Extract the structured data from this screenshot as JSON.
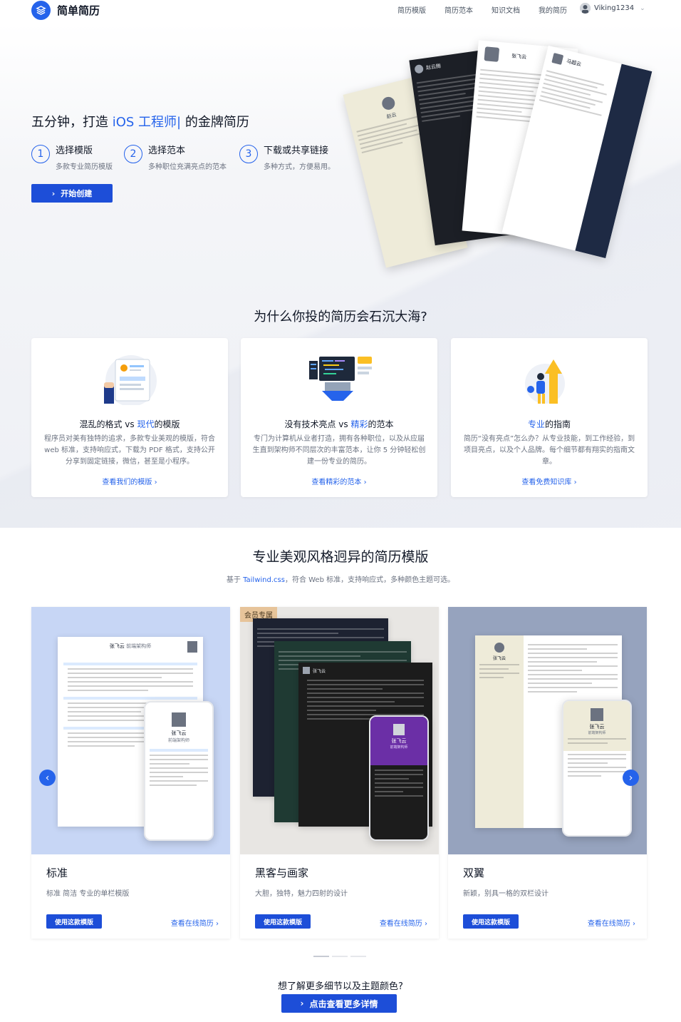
{
  "nav": {
    "brand": "简单简历",
    "links": [
      "简历模版",
      "简历范本",
      "知识文档",
      "我的简历"
    ],
    "username": "Viking1234"
  },
  "hero": {
    "title_prefix": "五分钟，打造 ",
    "title_highlight": "iOS 工程师|",
    "title_suffix": " 的金牌简历",
    "steps": [
      {
        "num": "1",
        "title": "选择模版",
        "desc": "多款专业简历模版"
      },
      {
        "num": "2",
        "title": "选择范本",
        "desc": "多种职位充满亮点的范本"
      },
      {
        "num": "3",
        "title": "下载或共享链接",
        "desc": "多种方式，方便易用。"
      }
    ],
    "cta": "开始创建",
    "preview_names": {
      "a": "赵云",
      "b": "赵云腾",
      "c": "张飞云",
      "d": "马超云"
    }
  },
  "why": {
    "heading": "为什么你投的简历会石沉大海?",
    "cards": [
      {
        "title_pre": "混乱的格式 vs ",
        "title_hl": "现代",
        "title_post": "的模版",
        "desc": "程序员对美有独特的追求，多款专业美观的模版，符合 web 标准，支持响应式，下载为 PDF 格式，支持公开分享到固定链接，微信，甚至是小程序。",
        "link": "查看我们的模版 ›"
      },
      {
        "title_pre": "没有技术亮点 vs ",
        "title_hl": "精彩",
        "title_post": "的范本",
        "desc": "专门为计算机从业者打造，拥有各种职位，以及从应届生直到架构师不同层次的丰富范本，让你 5 分钟轻松创建一份专业的简历。",
        "link": "查看精彩的范本 ›"
      },
      {
        "title_pre": "",
        "title_hl": "专业",
        "title_post": "的指南",
        "desc": "简历“没有亮点”怎么办？从专业技能，到工作经验，到项目亮点，以及个人品牌。每个细节都有翔实的指南文章。",
        "link": "查看免费知识库 ›"
      }
    ]
  },
  "templates": {
    "heading": "专业美观风格迥异的简历模版",
    "sub_pre": "基于 ",
    "sub_hl": "Tailwind.css",
    "sub_post": "，符合 Web 标准，支持响应式，多种颜色主题可选。",
    "items": [
      {
        "name": "标准",
        "desc": "标准 简洁 专业的单栏模版",
        "use": "使用这款模版",
        "view": "查看在线简历 ›",
        "preview_name": "张飞云",
        "preview_role": "前端架构师"
      },
      {
        "name": "黑客与画家",
        "desc": "大胆，独特，魅力四射的设计",
        "use": "使用这款模版",
        "view": "查看在线简历 ›",
        "badge": "会员专属",
        "preview_name": "张飞云",
        "preview_role": "前端架构师"
      },
      {
        "name": "双翼",
        "desc": "新颖，别具一格的双栏设计",
        "use": "使用这款模版",
        "view": "查看在线简历 ›",
        "preview_name": "张飞云",
        "preview_role": "前端架构师"
      }
    ],
    "more_q": "想了解更多细节以及主题颜色?",
    "more_btn": "点击查看更多详情"
  },
  "colors": {
    "accent": "#2563eb",
    "button": "#1d4ed8",
    "dark_navy": "#1e2a44",
    "cream": "#eeebd9"
  }
}
